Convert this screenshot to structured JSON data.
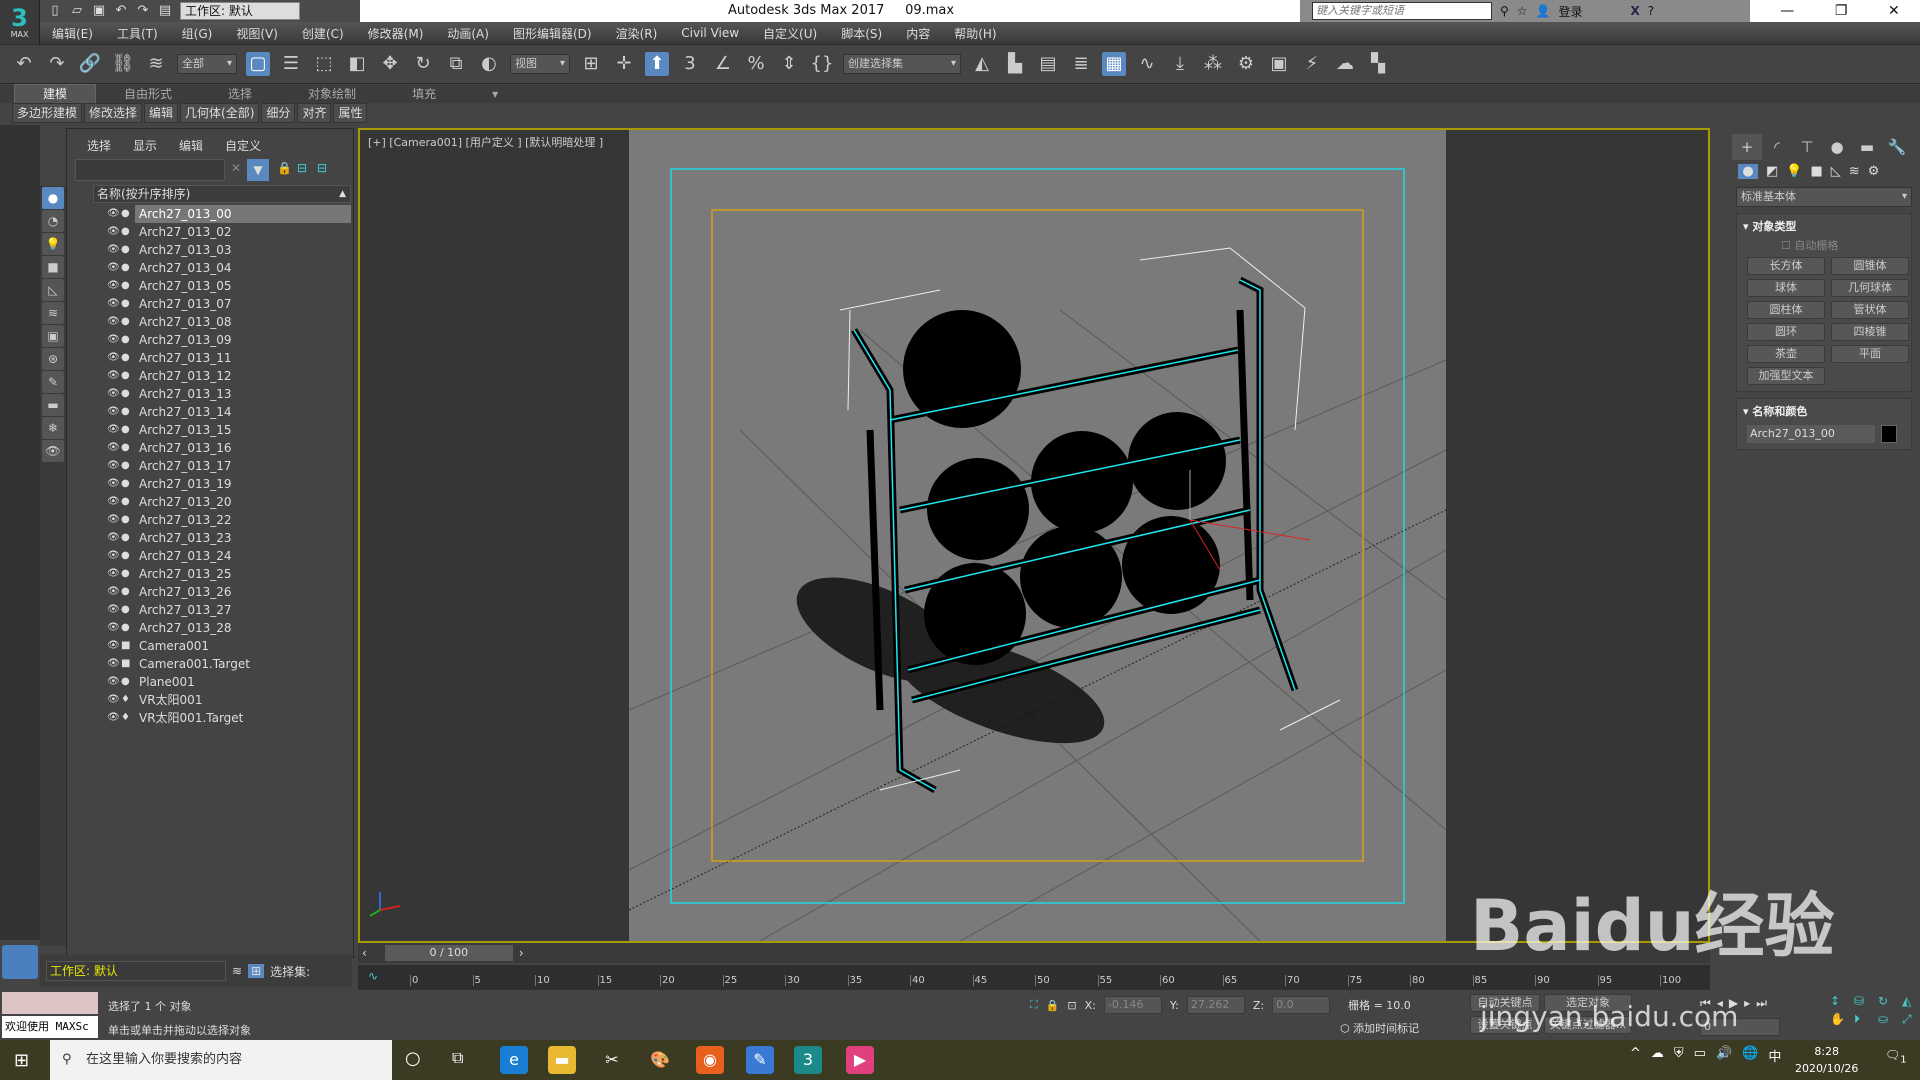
{
  "app": {
    "logo_number": "3",
    "logo_text": "MAX",
    "title": "Autodesk 3ds Max 2017",
    "file": "09.max",
    "workspace": "工作区: 默认",
    "search_placeholder": "键入关键字或短语",
    "login": "登录"
  },
  "menu": [
    "编辑(E)",
    "工具(T)",
    "组(G)",
    "视图(V)",
    "创建(C)",
    "修改器(M)",
    "动画(A)",
    "图形编辑器(D)",
    "渲染(R)",
    "Civil View",
    "自定义(U)",
    "脚本(S)",
    "内容",
    "帮助(H)"
  ],
  "toolbar": {
    "filter": "全部",
    "refcoord": "视图",
    "selset": "创建选择集"
  },
  "ribbon": {
    "tabs": [
      "建模",
      "自由形式",
      "选择",
      "对象绘制",
      "填充"
    ],
    "subtabs": [
      "多边形建模",
      "修改选择",
      "编辑",
      "几何体(全部)",
      "细分",
      "对齐",
      "属性"
    ]
  },
  "explorer": {
    "menu": [
      "选择",
      "显示",
      "编辑",
      "自定义"
    ],
    "header": "名称(按升序排序)",
    "items": [
      "Arch27_013_00",
      "Arch27_013_02",
      "Arch27_013_03",
      "Arch27_013_04",
      "Arch27_013_05",
      "Arch27_013_07",
      "Arch27_013_08",
      "Arch27_013_09",
      "Arch27_013_11",
      "Arch27_013_12",
      "Arch27_013_13",
      "Arch27_013_14",
      "Arch27_013_15",
      "Arch27_013_16",
      "Arch27_013_17",
      "Arch27_013_19",
      "Arch27_013_20",
      "Arch27_013_22",
      "Arch27_013_23",
      "Arch27_013_24",
      "Arch27_013_25",
      "Arch27_013_26",
      "Arch27_013_27",
      "Arch27_013_28",
      "Camera001",
      "Camera001.Target",
      "Plane001",
      "VR太阳001",
      "VR太阳001.Target"
    ],
    "workspace": "工作区: 默认",
    "selset": "选择集:"
  },
  "viewport": {
    "label": "[+] [Camera001] [用户定义 ] [默认明暗处理 ]"
  },
  "command": {
    "category": "标准基本体",
    "object_type": "对象类型",
    "autogrid": "自动栅格",
    "buttons": [
      "长方体",
      "圆锥体",
      "球体",
      "几何球体",
      "圆柱体",
      "管状体",
      "圆环",
      "四棱锥",
      "茶壶",
      "平面",
      "加强型文本"
    ],
    "name_color": "名称和颜色",
    "object_name": "Arch27_013_00",
    "object_color": "#000000"
  },
  "time": {
    "slider": "0 / 100",
    "ticks": [
      "0",
      "5",
      "10",
      "15",
      "20",
      "25",
      "30",
      "35",
      "40",
      "45",
      "50",
      "55",
      "60",
      "65",
      "70",
      "75",
      "80",
      "85",
      "90",
      "95",
      "100"
    ]
  },
  "status": {
    "maxscript": "欢迎使用 MAXSc",
    "selected": "选择了 1 个 对象",
    "hint": "单击或单击并拖动以选择对象",
    "x_label": "X:",
    "x": "-0.146",
    "y_label": "Y:",
    "y": "27.262",
    "z_label": "Z:",
    "z": "0.0",
    "grid": "栅格 = 10.0",
    "add_tag": "添加时间标记",
    "autokey": "自动关键点",
    "setkey": "设置关键点",
    "selobj": "选定对象",
    "keyfilter": "关键点过滤器...",
    "frame": "0"
  },
  "taskbar": {
    "search": "在这里输入你要搜索的内容",
    "time": "8:28",
    "date": "2020/10/26",
    "ime": "中",
    "notif": "1"
  },
  "watermark": {
    "logo": "Baidu经验",
    "url": "jingyan.baidu.com"
  }
}
